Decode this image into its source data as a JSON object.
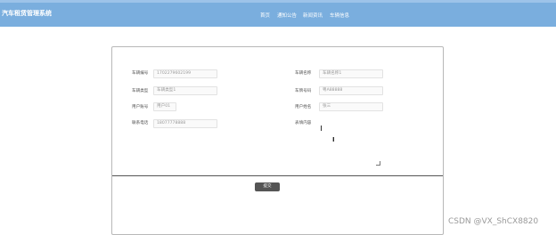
{
  "header": {
    "brand": "汽车租赁管理系统",
    "nav": [
      "首页",
      "通知公告",
      "新闻资讯",
      "车辆信息"
    ]
  },
  "form": {
    "fields": [
      {
        "label": "车辆编号",
        "value": "1702279602199"
      },
      {
        "label": "车辆名称",
        "value": "车辆名称1"
      },
      {
        "label": "车辆类型",
        "value": "车辆类型1"
      },
      {
        "label": "车牌号码",
        "value": "粤A88888"
      },
      {
        "label": "用户账号",
        "value": "用户01"
      },
      {
        "label": "用户姓名",
        "value": "张三"
      },
      {
        "label": "联系电话",
        "value": "18077778888"
      },
      {
        "label": "表填内容",
        "value": ""
      }
    ],
    "submit_label": "提交"
  },
  "watermark": "CSDN @VX_ShCX8820"
}
